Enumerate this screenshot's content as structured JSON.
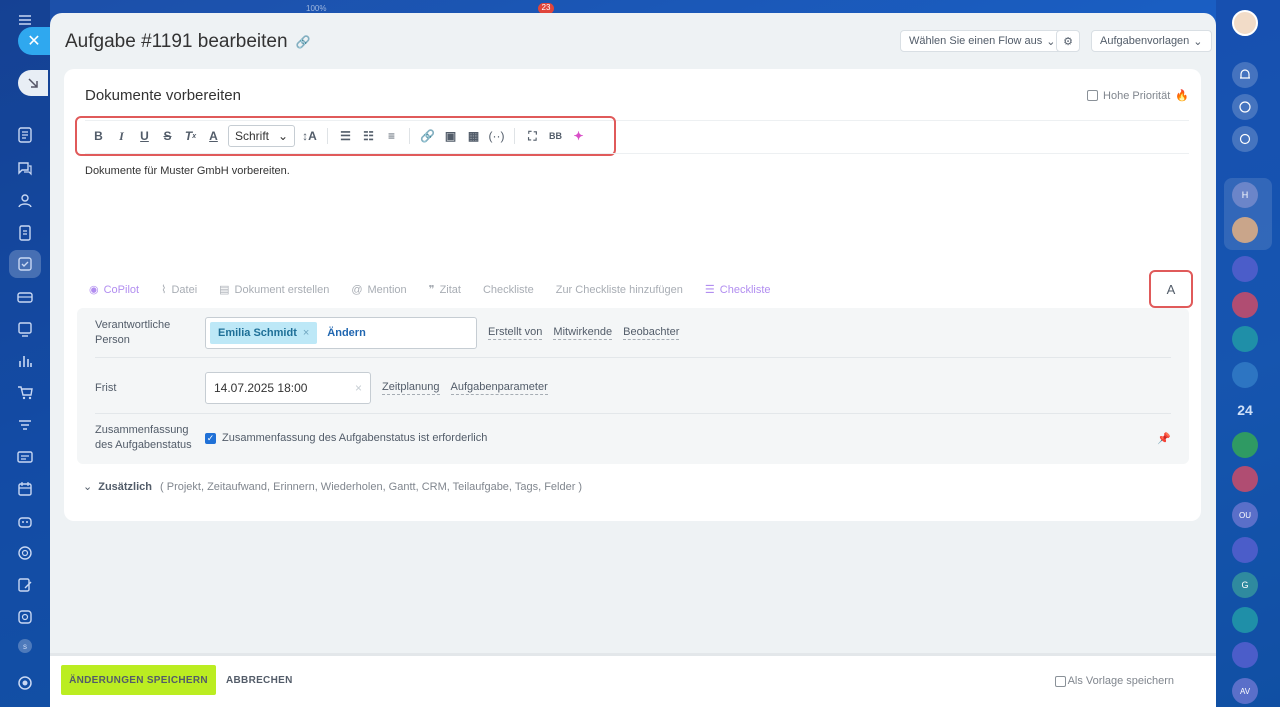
{
  "top_strip": {
    "zoom": "100%",
    "badge": "23"
  },
  "header": {
    "title": "Aufgabe #1191 bearbeiten",
    "flow_button": "Wählen Sie einen Flow aus",
    "templates_button": "Aufgabenvorlagen"
  },
  "task": {
    "title": "Dokumente vorbereiten",
    "high_priority_label": "Hohe Priorität",
    "description": "Dokumente für Muster GmbH vorbereiten.",
    "font_select": "Schrift"
  },
  "actions": [
    {
      "label": "CoPilot",
      "icon": "copilot-icon"
    },
    {
      "label": "Datei",
      "icon": "paperclip-icon"
    },
    {
      "label": "Dokument erstellen",
      "icon": "document-icon"
    },
    {
      "label": "Mention",
      "icon": "at-icon"
    },
    {
      "label": "Zitat",
      "icon": "quote-icon"
    },
    {
      "label": "Checkliste",
      "icon": ""
    },
    {
      "label": "Zur Checkliste hinzufügen",
      "icon": ""
    },
    {
      "label": "Checkliste",
      "icon": "checklist-icon"
    }
  ],
  "format_button_label": "A",
  "fields": {
    "responsible_label": "Verantwortliche Person",
    "responsible_person": "Emilia Schmidt",
    "change_label": "Ändern",
    "created_by": "Erstellt von",
    "participants": "Mitwirkende",
    "observers": "Beobachter",
    "deadline_label": "Frist",
    "deadline_value": "14.07.2025 18:00",
    "scheduling": "Zeitplanung",
    "task_params": "Aufgabenparameter",
    "summary_label": "Zusammenfassung des Aufgabenstatus",
    "summary_check": "Zusammenfassung des Aufgabenstatus ist erforderlich"
  },
  "extra": {
    "label": "Zusätzlich",
    "items": "( Projekt,  Zeitaufwand,  Erinnern,  Wiederholen,  Gantt,  CRM,  Teilaufgabe,  Tags,  Felder )"
  },
  "footer": {
    "save": "ÄNDERUNGEN SPEICHERN",
    "cancel": "ABBRECHEN",
    "save_template": "Als Vorlage speichern"
  },
  "right_sidebar": {
    "counter": "24",
    "avatar_initials": [
      "H",
      "OU",
      "G",
      "AV"
    ]
  },
  "colors": {
    "accent": "#bbed21",
    "link": "#2066b0",
    "highlight_border": "#e05a5a"
  }
}
